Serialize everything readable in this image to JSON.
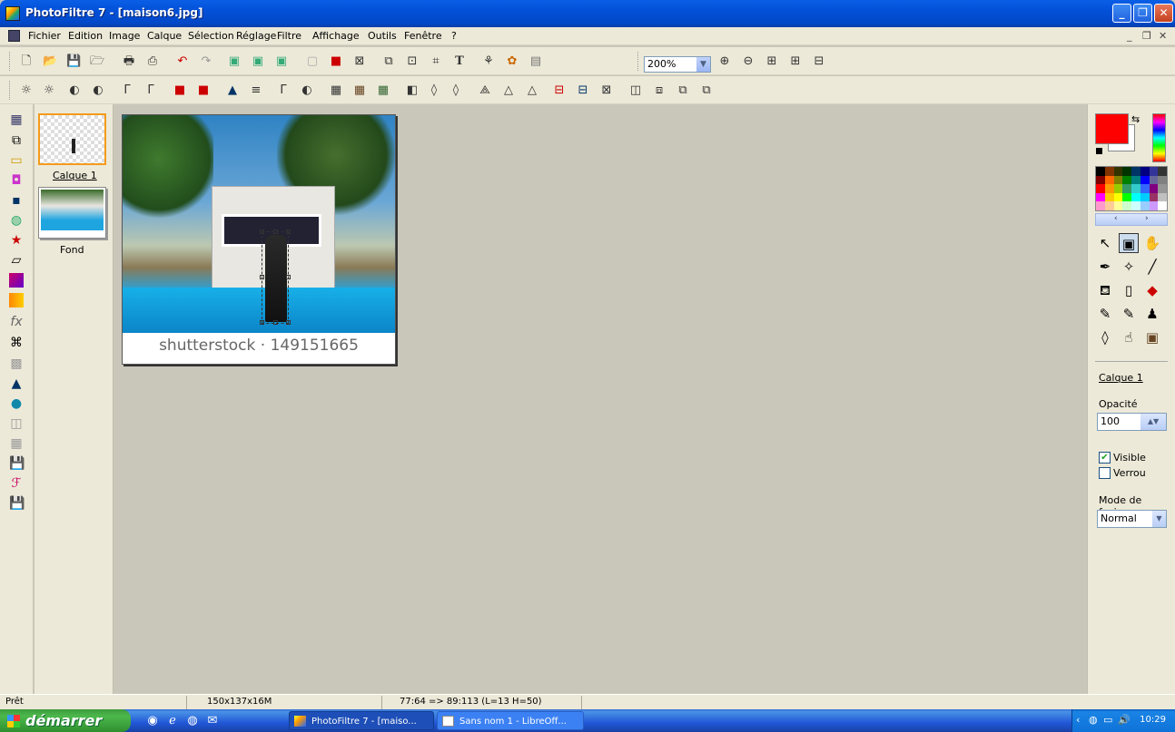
{
  "window": {
    "title": "PhotoFiltre 7 - [maison6.jpg]"
  },
  "menu": [
    "Fichier",
    "Edition",
    "Image",
    "Calque",
    "Sélection",
    "Réglage",
    "Filtre",
    "Affichage",
    "Outils",
    "Fenêtre",
    "?"
  ],
  "mdi_controls": {
    "minimize": "_",
    "restore": "❐",
    "close": "✕"
  },
  "toolbar": {
    "zoom_value": "200%"
  },
  "layers": [
    {
      "name": "Calque 1",
      "selected": true
    },
    {
      "name": "Fond",
      "selected": false
    }
  ],
  "image": {
    "watermark": "shutterstock · 149151665"
  },
  "right_panel": {
    "fg_color": "#ff0000",
    "bg_color": "#ffffff",
    "layer_name": "Calque 1",
    "opacity_label": "Opacité",
    "opacity_value": "100",
    "visible_label": "Visible",
    "visible_checked": true,
    "lock_label": "Verrou",
    "lock_checked": false,
    "blend_label": "Mode de fusion",
    "blend_value": "Normal"
  },
  "status": {
    "state": "Prêt",
    "size": "150x137x16M",
    "coords": "77:64 => 89:113 (L=13  H=50)"
  },
  "taskbar": {
    "start_label": "démarrer",
    "tasks": [
      {
        "label": "PhotoFiltre 7 - [maiso...",
        "active": true
      },
      {
        "label": "Sans nom 1 - LibreOff...",
        "active": false
      }
    ],
    "clock": "10:29"
  },
  "palette_colors": [
    "#000000",
    "#7f3300",
    "#333300",
    "#003300",
    "#003366",
    "#000080",
    "#333399",
    "#333333",
    "#800000",
    "#ff6600",
    "#808000",
    "#008000",
    "#008080",
    "#0000ff",
    "#666699",
    "#808080",
    "#ff0000",
    "#ff9900",
    "#99cc00",
    "#339966",
    "#33cccc",
    "#3366ff",
    "#800080",
    "#969696",
    "#ff00ff",
    "#ffcc00",
    "#ffff00",
    "#00ff00",
    "#00ffff",
    "#00ccff",
    "#993366",
    "#c0c0c0",
    "#ff99cc",
    "#ffcc99",
    "#ffff99",
    "#ccffcc",
    "#ccffff",
    "#99ccff",
    "#cc99ff",
    "#ffffff"
  ]
}
